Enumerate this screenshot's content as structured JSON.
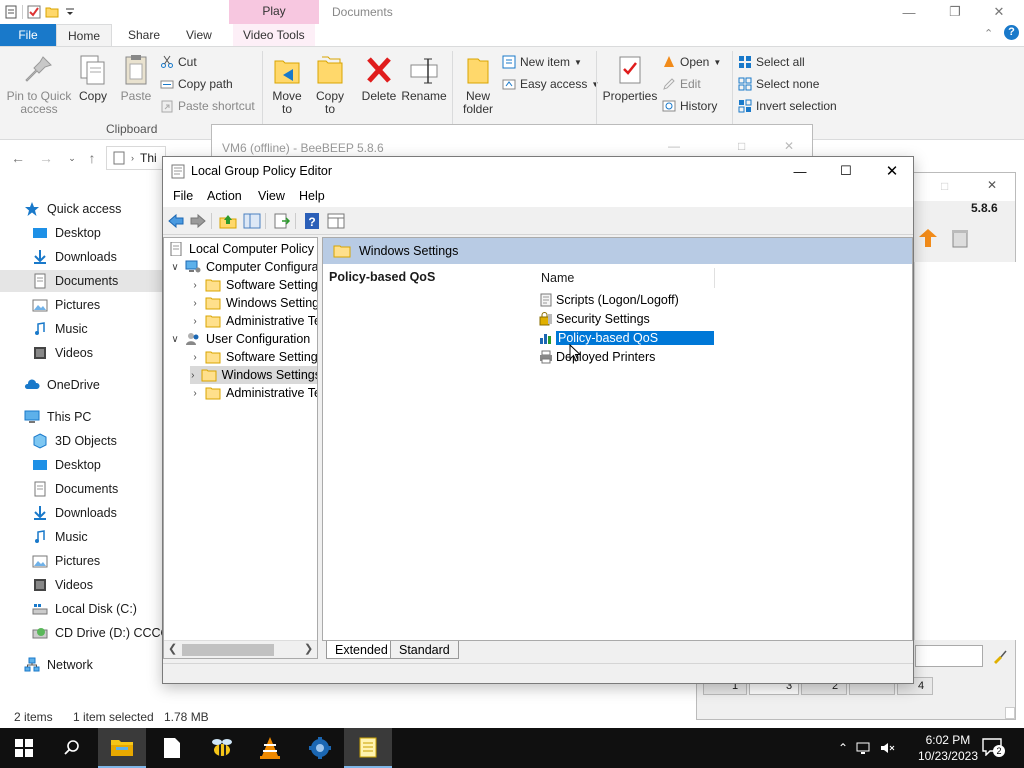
{
  "explorer": {
    "contextual_tab_header": "Play",
    "window_title": "Documents",
    "tabs": [
      "File",
      "Home",
      "Share",
      "View",
      "Video Tools"
    ],
    "ribbon": {
      "pin_to_quick_access": "Pin to Quick\naccess",
      "copy": "Copy",
      "paste": "Paste",
      "cut": "Cut",
      "copy_path": "Copy path",
      "paste_shortcut": "Paste shortcut",
      "clipboard_group": "Clipboard",
      "move_to": "Move\nto",
      "copy_to": "Copy\nto",
      "delete": "Delete",
      "rename": "Rename",
      "new_folder": "New\nfolder",
      "new_item": "New item",
      "easy_access": "Easy access",
      "properties": "Properties",
      "open": "Open",
      "edit": "Edit",
      "history": "History",
      "select_all": "Select all",
      "select_none": "Select none",
      "invert_selection": "Invert selection"
    },
    "address_fragment": "Thi",
    "nav": {
      "quick_access": "Quick access",
      "qa_items": [
        "Desktop",
        "Downloads",
        "Documents",
        "Pictures",
        "Music",
        "Videos"
      ],
      "onedrive": "OneDrive",
      "this_pc": "This PC",
      "pc_items": [
        "3D Objects",
        "Desktop",
        "Documents",
        "Downloads",
        "Music",
        "Pictures",
        "Videos",
        "Local Disk (C:)",
        "CD Drive (D:) CCCOMA"
      ],
      "network": "Network"
    },
    "status": {
      "items": "2 items",
      "selected": "1 item selected",
      "size": "1.78 MB"
    }
  },
  "beebeep": {
    "title": "VM6 (offline) - BeeBEEP 5.8.6",
    "version": "5.8.6",
    "bottom_tabs": [
      "1",
      "3",
      "2",
      "",
      "4"
    ]
  },
  "gpedit": {
    "title": "Local Group Policy Editor",
    "menu": [
      "File",
      "Action",
      "View",
      "Help"
    ],
    "tree": {
      "root": "Local Computer Policy",
      "computer_config": "Computer Configuration",
      "cc_children": [
        "Software Settings",
        "Windows Settings",
        "Administrative Templates"
      ],
      "user_config": "User Configuration",
      "uc_children": [
        "Software Settings",
        "Windows Settings",
        "Administrative Templates"
      ]
    },
    "right_header": "Windows Settings",
    "description_title": "Policy-based QoS",
    "column_name": "Name",
    "items": [
      "Scripts (Logon/Logoff)",
      "Security Settings",
      "Policy-based QoS",
      "Deployed Printers"
    ],
    "selected_item": "Policy-based QoS",
    "view_tabs": [
      "Extended",
      "Standard"
    ]
  },
  "taskbar": {
    "time": "6:02 PM",
    "date": "10/23/2023",
    "notifications_count": "2"
  },
  "colors": {
    "accent": "#0078d7",
    "file_tab": "#1979ca",
    "context_tab": "#f7c7e0",
    "pane_header": "#b8cbe4",
    "taskbar": "#101010"
  }
}
